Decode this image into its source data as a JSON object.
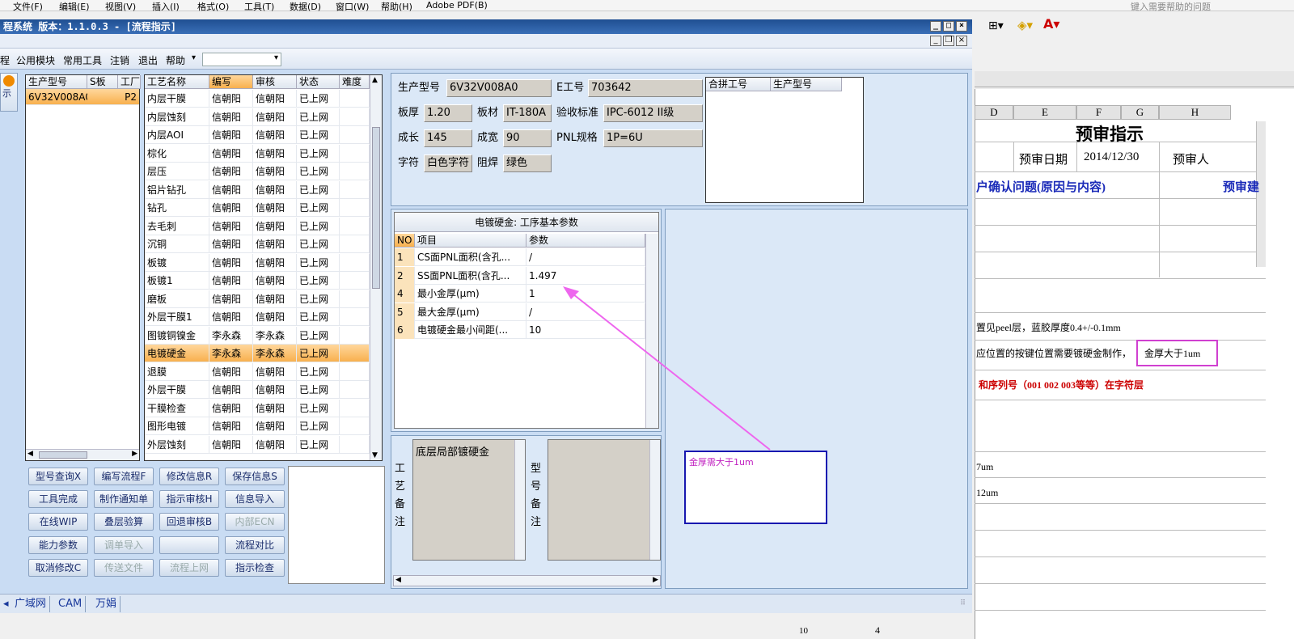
{
  "excel_menu": [
    "文件(F)",
    "编辑(E)",
    "视图(V)",
    "插入(I)",
    "格式(O)",
    "工具(T)",
    "数据(D)",
    "窗口(W)",
    "帮助(H)",
    "Adobe PDF(B)"
  ],
  "excel_help_placeholder": "键入需要帮助的问题",
  "excel": {
    "col_headers": [
      "D",
      "E",
      "F",
      "G",
      "H"
    ],
    "title": "预审指示",
    "review_date_label": "预审日期",
    "review_date": "2014/12/30",
    "reviewer_label": "预审人",
    "confirm_label": "户确认问题(原因与内容)",
    "review_label2": "预审建",
    "line1": "置见peel层，蓝胶厚度0.4+/-0.1mm",
    "line2_a": "应位置的按键位置需要镀硬金制作，",
    "line2_b": "金厚大于1um",
    "line3": "和序列号（001 002 003等等）在字符层",
    "line4": "7um",
    "line5": "12um",
    "row_num": "10",
    "row_val": "4"
  },
  "main_window": {
    "title": "程系统   版本：1.1.0.3 - [流程指示]",
    "menu": [
      "程",
      "公用模块",
      "常用工具",
      "注销",
      "退出",
      "帮助"
    ],
    "left_btn_label": "示"
  },
  "model_list": {
    "headers": [
      "生产型号",
      "S板",
      "工厂"
    ],
    "rows": [
      [
        "6V32V008A0",
        "",
        "P2"
      ]
    ]
  },
  "process_table": {
    "headers": [
      "工艺名称",
      "编写",
      "审核",
      "状态",
      "难度"
    ],
    "rows": [
      [
        "内层干膜",
        "信朝阳",
        "信朝阳",
        "已上网",
        ""
      ],
      [
        "内层蚀刻",
        "信朝阳",
        "信朝阳",
        "已上网",
        ""
      ],
      [
        "内层AOI",
        "信朝阳",
        "信朝阳",
        "已上网",
        ""
      ],
      [
        "棕化",
        "信朝阳",
        "信朝阳",
        "已上网",
        ""
      ],
      [
        "层压",
        "信朝阳",
        "信朝阳",
        "已上网",
        ""
      ],
      [
        "铝片钻孔",
        "信朝阳",
        "信朝阳",
        "已上网",
        ""
      ],
      [
        "钻孔",
        "信朝阳",
        "信朝阳",
        "已上网",
        ""
      ],
      [
        "去毛刺",
        "信朝阳",
        "信朝阳",
        "已上网",
        ""
      ],
      [
        "沉铜",
        "信朝阳",
        "信朝阳",
        "已上网",
        ""
      ],
      [
        "板镀",
        "信朝阳",
        "信朝阳",
        "已上网",
        ""
      ],
      [
        "板镀1",
        "信朝阳",
        "信朝阳",
        "已上网",
        ""
      ],
      [
        "磨板",
        "信朝阳",
        "信朝阳",
        "已上网",
        ""
      ],
      [
        "外层干膜1",
        "信朝阳",
        "信朝阳",
        "已上网",
        ""
      ],
      [
        "图镀铜镍金",
        "李永森",
        "李永森",
        "已上网",
        ""
      ],
      [
        "电镀硬金",
        "李永森",
        "李永森",
        "已上网",
        ""
      ],
      [
        "退膜",
        "信朝阳",
        "信朝阳",
        "已上网",
        ""
      ],
      [
        "外层干膜",
        "信朝阳",
        "信朝阳",
        "已上网",
        ""
      ],
      [
        "干膜检查",
        "信朝阳",
        "信朝阳",
        "已上网",
        ""
      ],
      [
        "图形电镀",
        "信朝阳",
        "信朝阳",
        "已上网",
        ""
      ],
      [
        "外层蚀刻",
        "信朝阳",
        "信朝阳",
        "已上网",
        ""
      ]
    ],
    "selected_index": 14
  },
  "buttons": [
    [
      "型号查询X",
      "编写流程F",
      "修改信息R",
      "保存信息S"
    ],
    [
      "工具完成",
      "制作通知单",
      "指示审核H",
      "信息导入"
    ],
    [
      "在线WIP",
      "叠层验算",
      "回退审核B",
      "内部ECN"
    ],
    [
      "能力参数",
      "调单导入",
      "",
      "流程对比"
    ],
    [
      "取消修改C",
      "传送文件",
      "流程上网",
      "指示检查"
    ]
  ],
  "disabled_buttons": [
    "内部ECN",
    "调单导入",
    "传送文件",
    "流程上网"
  ],
  "info": {
    "model_label": "生产型号",
    "model": "6V32V008A0",
    "e_label": "E工号",
    "e": "703642",
    "thick_label": "板厚",
    "thick": "1.20",
    "mat_label": "板材",
    "mat": "IT-180A",
    "std_label": "验收标准",
    "std": "IPC-6012 II级",
    "len_label": "成长",
    "len": "145",
    "wid_label": "成宽",
    "wid": "90",
    "pnl_label": "PNL规格",
    "pnl": "1P=6U",
    "silk_label": "字符",
    "silk": "白色字符",
    "mask_label": "阻焊",
    "mask": "绿色"
  },
  "merge_list": {
    "headers": [
      "合拼工号",
      "生产型号"
    ]
  },
  "params": {
    "title": "电镀硬金: 工序基本参数",
    "headers": [
      "NO",
      "项目",
      "参数"
    ],
    "rows": [
      [
        "1",
        "CS面PNL面积(含孔...",
        "/"
      ],
      [
        "2",
        "SS面PNL面积(含孔...",
        "1.497"
      ],
      [
        "4",
        "最小金厚(μm)",
        "1"
      ],
      [
        "5",
        "最大金厚(μm)",
        "/"
      ],
      [
        "6",
        "电镀硬金最小间距(...",
        "10"
      ]
    ]
  },
  "notes": {
    "process_label": "工艺备注",
    "process_value": "底层局部镀硬金",
    "model_label": "型号备注"
  },
  "callout_text": "金厚需大于1um",
  "status_tabs": [
    "广域网",
    "CAM",
    "万娟"
  ]
}
